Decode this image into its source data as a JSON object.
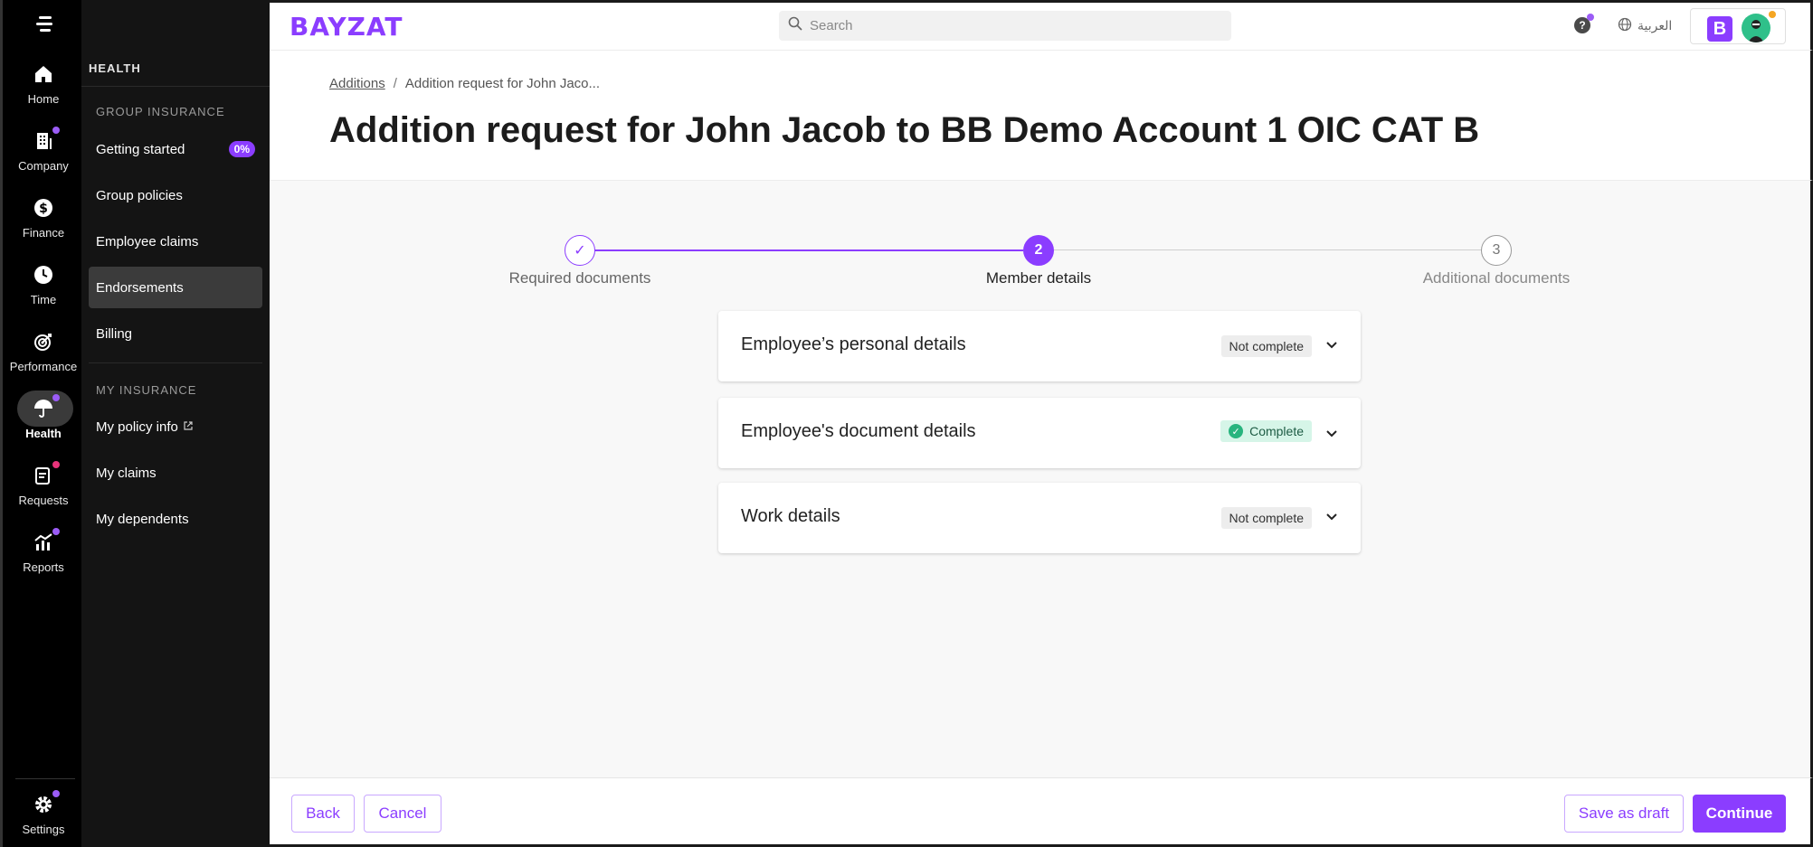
{
  "rail": {
    "items": [
      {
        "label": "Home",
        "icon": "home-icon"
      },
      {
        "label": "Company",
        "icon": "building-icon"
      },
      {
        "label": "Finance",
        "icon": "dollar-icon"
      },
      {
        "label": "Time",
        "icon": "clock-icon"
      },
      {
        "label": "Performance",
        "icon": "target-icon"
      },
      {
        "label": "Health",
        "icon": "umbrella-icon"
      },
      {
        "label": "Requests",
        "icon": "clipboard-icon"
      },
      {
        "label": "Reports",
        "icon": "bar-chart-icon"
      }
    ],
    "settings_label": "Settings"
  },
  "sidebar": {
    "title": "HEALTH",
    "group_insurance_label": "GROUP INSURANCE",
    "group_items": [
      {
        "label": "Getting started",
        "badge": "0%"
      },
      {
        "label": "Group policies"
      },
      {
        "label": "Employee claims"
      },
      {
        "label": "Endorsements"
      },
      {
        "label": "Billing"
      }
    ],
    "my_insurance_label": "MY INSURANCE",
    "my_items": [
      {
        "label": "My policy info"
      },
      {
        "label": "My claims"
      },
      {
        "label": "My dependents"
      }
    ]
  },
  "topbar": {
    "logo": "BAYZAT",
    "search_placeholder": "Search",
    "help": "?",
    "language": "العربية",
    "account_initial": "B"
  },
  "header": {
    "breadcrumb_link": "Additions",
    "breadcrumb_separator": "/",
    "breadcrumb_current": "Addition request for John Jaco...",
    "title": "Addition request for John Jacob to BB Demo Account 1 OIC CAT B"
  },
  "stepper": {
    "steps": [
      {
        "number": "✓",
        "label": "Required documents",
        "state": "done"
      },
      {
        "number": "2",
        "label": "Member details",
        "state": "current"
      },
      {
        "number": "3",
        "label": "Additional documents",
        "state": "upcoming"
      }
    ]
  },
  "sections": [
    {
      "title": "Employee’s personal details",
      "status": "Not complete"
    },
    {
      "title": "Employee's document details",
      "status": "Complete"
    },
    {
      "title": "Work details",
      "status": "Not complete"
    }
  ],
  "footer": {
    "back": "Back",
    "cancel": "Cancel",
    "save_draft": "Save as draft",
    "continue": "Continue"
  },
  "colors": {
    "accent": "#8b3dff",
    "rail_bg": "#000000",
    "sidebar_bg": "#141414",
    "complete_bg": "#d6f5e8",
    "complete_icon": "#28b47e"
  }
}
